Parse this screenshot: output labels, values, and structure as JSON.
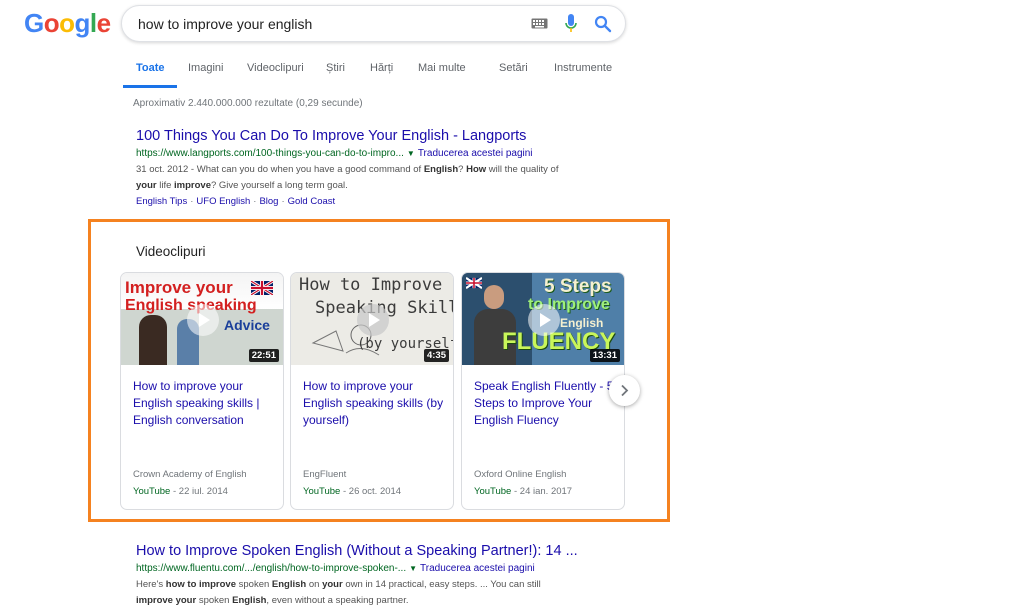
{
  "logo": {
    "letters": [
      "G",
      "o",
      "o",
      "g",
      "l",
      "e"
    ],
    "colors": [
      "#4285F4",
      "#EA4335",
      "#FBBC05",
      "#4285F4",
      "#34A853",
      "#EA4335"
    ]
  },
  "search": {
    "query": "how to improve your english"
  },
  "icons": {
    "keyboard": "keyboard-icon",
    "mic": "mic-icon",
    "search": "search-icon",
    "next": "chevron-right-icon",
    "play": "play-icon"
  },
  "tabs": [
    {
      "label": "Toate",
      "active": true
    },
    {
      "label": "Imagini"
    },
    {
      "label": "Videoclipuri"
    },
    {
      "label": "Știri"
    },
    {
      "label": "Hărți"
    },
    {
      "label": "Mai multe"
    },
    {
      "label": "Setări"
    },
    {
      "label": "Instrumente"
    }
  ],
  "stats": "Aproximativ 2.440.000.000 rezultate (0,29 secunde)",
  "results": [
    {
      "title": "100 Things You Can Do To Improve Your English - Langports",
      "url": "https://www.langports.com/100-things-you-can-do-to-impro...",
      "translate": "Traducerea acestei pagini",
      "snippet_parts": [
        {
          "t": "31 oct. 2012 - What can you do when you have a good command of "
        },
        {
          "t": "English",
          "b": true
        },
        {
          "t": "? "
        },
        {
          "t": "How",
          "b": true
        },
        {
          "t": " will the quality of "
        },
        {
          "br": true
        },
        {
          "t": "your",
          "b": true
        },
        {
          "t": " life "
        },
        {
          "t": "improve",
          "b": true
        },
        {
          "t": "? Give yourself a long term goal."
        }
      ],
      "sitelinks": [
        "English Tips",
        "UFO English",
        "Blog",
        "Gold Coast"
      ]
    },
    {
      "title": "How to Improve Spoken English (Without a Speaking Partner!): 14 ...",
      "url": "https://www.fluentu.com/.../english/how-to-improve-spoken-...",
      "translate": "Traducerea acestei pagini",
      "snippet_parts": [
        {
          "t": "Here's "
        },
        {
          "t": "how to improve",
          "b": true
        },
        {
          "t": " spoken "
        },
        {
          "t": "English",
          "b": true
        },
        {
          "t": " on "
        },
        {
          "t": "your",
          "b": true
        },
        {
          "t": " own in 14 practical, easy steps. ... You can still "
        },
        {
          "br": true
        },
        {
          "t": "improve your",
          "b": true
        },
        {
          "t": " spoken "
        },
        {
          "t": "English",
          "b": true
        },
        {
          "t": ", even without a speaking partner."
        }
      ]
    }
  ],
  "videos": {
    "heading": "Videoclipuri",
    "items": [
      {
        "thumb_lines": [
          "Improve your",
          "English speaking",
          "Advice"
        ],
        "duration": "22:51",
        "title": "How to improve your English speaking skills | English conversation",
        "channel": "Crown Academy of English",
        "source": "YouTube",
        "date": "22 iul. 2014"
      },
      {
        "thumb_lines": [
          "How to Improve",
          "Speaking Skills",
          "(by yourself)"
        ],
        "duration": "4:35",
        "title": "How to improve your English speaking skills (by yourself)",
        "channel": "EngFluent",
        "source": "YouTube",
        "date": "26 oct. 2014"
      },
      {
        "thumb_lines": [
          "5 Steps",
          "to Improve",
          "English",
          "FLUENCY"
        ],
        "duration": "13:31",
        "title": "Speak English Fluently - 5 Steps to Improve Your English Fluency",
        "channel": "Oxford Online English",
        "source": "YouTube",
        "date": "24 ian. 2017"
      }
    ]
  },
  "colors": {
    "link": "#1a0dab",
    "url_green": "#006621",
    "accent_blue": "#1a73e8",
    "highlight_orange": "#f58220"
  }
}
